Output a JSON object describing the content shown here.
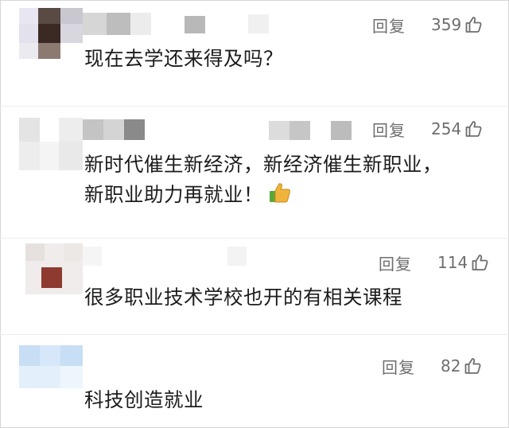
{
  "comments": [
    {
      "reply_label": "回复",
      "like_count": "359",
      "text": "现在去学还来得及吗？"
    },
    {
      "reply_label": "回复",
      "like_count": "254",
      "text_line1": "新时代催生新经济，新经济催生新职业，",
      "text_line2": "新职业助力再就业！",
      "emoji": "thumbs-up-emoji"
    },
    {
      "reply_label": "回复",
      "like_count": "114",
      "text": "很多职业技术学校也开的有相关课程"
    },
    {
      "reply_label": "回复",
      "like_count": "82",
      "text": "科技创造就业"
    }
  ],
  "icons": {
    "like": "thumbs-up-outline-icon"
  },
  "colors": {
    "action_text": "#6e6e6e",
    "comment_text": "#1c1c1c",
    "emoji_thumb": "#f0b43c",
    "emoji_cuff": "#5aa83a"
  }
}
